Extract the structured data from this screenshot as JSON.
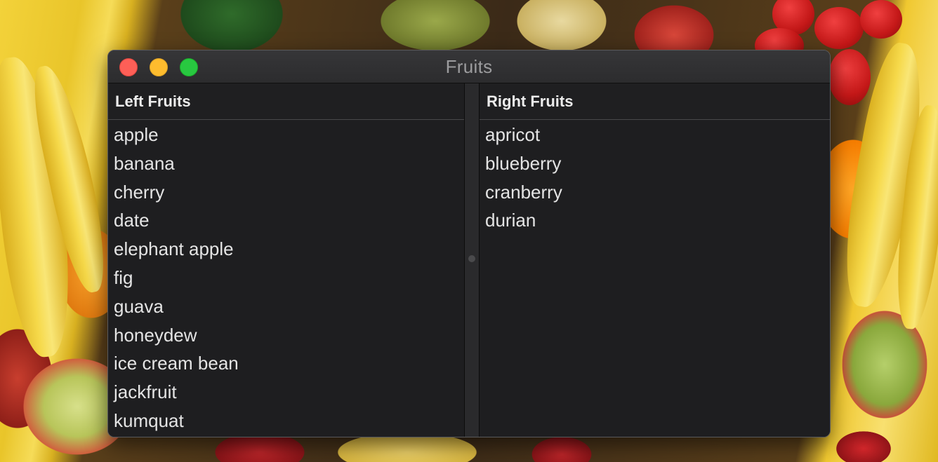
{
  "window": {
    "title": "Fruits"
  },
  "left_pane": {
    "header": "Left Fruits",
    "items": [
      "apple",
      "banana",
      "cherry",
      "date",
      "elephant apple",
      "fig",
      "guava",
      "honeydew",
      "ice cream bean",
      "jackfruit",
      "kumquat"
    ]
  },
  "right_pane": {
    "header": "Right Fruits",
    "items": [
      "apricot",
      "blueberry",
      "cranberry",
      "durian"
    ]
  },
  "colors": {
    "window_background": "#1e1e20",
    "title_text": "#9c9c9e",
    "list_text": "#e4e4e4",
    "close_button": "#fe5f57",
    "minimize_button": "#febc2e",
    "zoom_button": "#28c840"
  },
  "icons": [
    "close-icon",
    "minimize-icon",
    "zoom-icon",
    "splitter-grip-icon"
  ]
}
